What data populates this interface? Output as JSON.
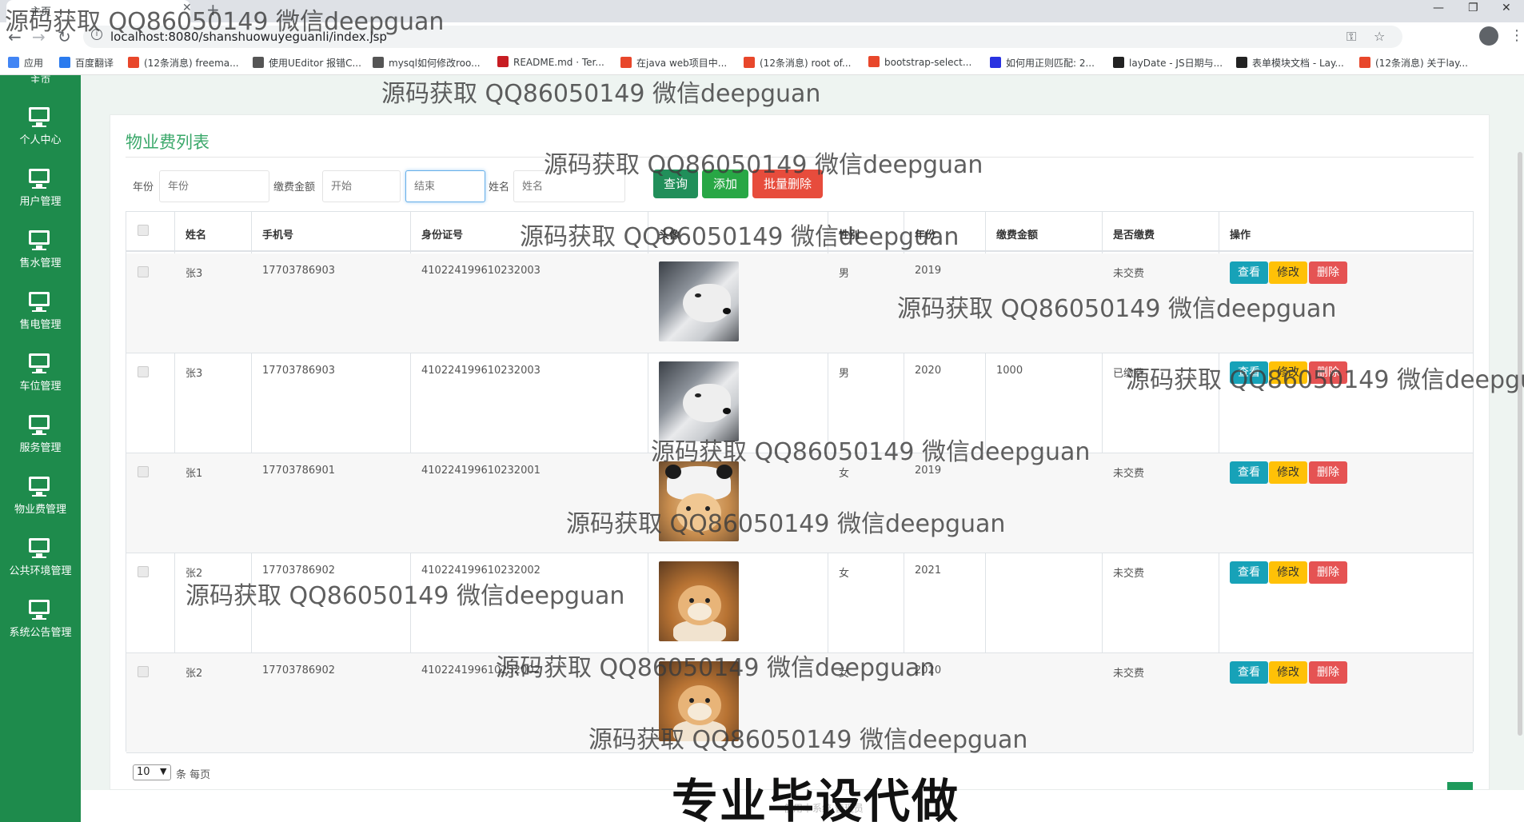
{
  "browser": {
    "tab_title": "主页",
    "url": "localhost:8080/shanshuowuyeguanli/index.jsp",
    "bookmarks": [
      {
        "label": "应用",
        "icon": "apps-grid-icon",
        "color": "#4285f4"
      },
      {
        "label": "百度翻译",
        "icon": "baidu-translate-icon",
        "color": "#2b7bee"
      },
      {
        "label": "(12条消息) freema...",
        "icon": "csdn-icon",
        "color": "#e8472b"
      },
      {
        "label": "使用UEditor 报错C...",
        "icon": "ueditor-icon",
        "color": "#555555"
      },
      {
        "label": "mysql如何修改roo...",
        "icon": "link-icon",
        "color": "#555555"
      },
      {
        "label": "README.md · Ter...",
        "icon": "gitee-icon",
        "color": "#c71d23"
      },
      {
        "label": "在java web项目中...",
        "icon": "csdn-icon",
        "color": "#e8472b"
      },
      {
        "label": "(12条消息) root of...",
        "icon": "csdn-icon",
        "color": "#e8472b"
      },
      {
        "label": "bootstrap-select...",
        "icon": "oschina-icon",
        "color": "#e8472b"
      },
      {
        "label": "如何用正则匹配: 2...",
        "icon": "baidu-icon",
        "color": "#2932e1"
      },
      {
        "label": "layDate - JS日期与...",
        "icon": "layui-icon",
        "color": "#222222"
      },
      {
        "label": "表单模块文档 - Lay...",
        "icon": "layui-icon",
        "color": "#222222"
      },
      {
        "label": "(12条消息) 关于lay...",
        "icon": "csdn-icon",
        "color": "#e8472b"
      }
    ]
  },
  "sidebar": {
    "top_partial": "主页",
    "items": [
      {
        "label": "个人中心"
      },
      {
        "label": "用户管理"
      },
      {
        "label": "售水管理"
      },
      {
        "label": "售电管理"
      },
      {
        "label": "车位管理"
      },
      {
        "label": "服务管理"
      },
      {
        "label": "物业费管理"
      },
      {
        "label": "公共环境管理"
      },
      {
        "label": "系统公告管理"
      }
    ]
  },
  "page": {
    "title": "物业费列表",
    "filters": {
      "year_label": "年份",
      "year_placeholder": "年份",
      "amount_label": "缴费金额",
      "amount_start_placeholder": "开始",
      "amount_end_placeholder": "结束",
      "name_label": "姓名",
      "name_placeholder": "姓名"
    },
    "buttons": {
      "query": "查询",
      "add": "添加",
      "batch_delete": "批量删除"
    },
    "table": {
      "headers": [
        "姓名",
        "手机号",
        "身份证号",
        "头像",
        "性别",
        "年份",
        "缴费金额",
        "是否缴费",
        "操作"
      ],
      "rows": [
        {
          "name": "张3",
          "phone": "17703786903",
          "id_card": "410224199610232003",
          "avatar": "husky",
          "gender": "男",
          "year": "2019",
          "amount": "",
          "paid": "未交费"
        },
        {
          "name": "张3",
          "phone": "17703786903",
          "id_card": "410224199610232003",
          "avatar": "husky",
          "gender": "男",
          "year": "2020",
          "amount": "1000",
          "paid": "已缴费"
        },
        {
          "name": "张1",
          "phone": "17703786901",
          "id_card": "410224199610232001",
          "avatar": "panda",
          "gender": "女",
          "year": "2019",
          "amount": "",
          "paid": "未交费"
        },
        {
          "name": "张2",
          "phone": "17703786902",
          "id_card": "410224199610232002",
          "avatar": "shiba",
          "gender": "女",
          "year": "2021",
          "amount": "",
          "paid": "未交费"
        },
        {
          "name": "张2",
          "phone": "17703786902",
          "id_card": "410224199610232002",
          "avatar": "shiba",
          "gender": "女",
          "year": "2020",
          "amount": "",
          "paid": "未交费"
        }
      ],
      "row_actions": {
        "view": "查看",
        "edit": "修改",
        "delete": "删除"
      }
    },
    "pagination": {
      "page_size": "10",
      "suffix": "条 每页"
    }
  },
  "footer": {
    "text": "使用本系统 管理员"
  },
  "overlay": {
    "watermark": "源码获取 QQ86050149 微信deepguan",
    "watermark_cut": "源码获取 QQ86050149 微信deepgu",
    "banner": "专业毕设代做"
  },
  "colors": {
    "sidebar": "#1e8b4c",
    "title": "#3aa86a",
    "view": "#17a2b8",
    "edit": "#ffc107",
    "delete": "#e55353"
  }
}
